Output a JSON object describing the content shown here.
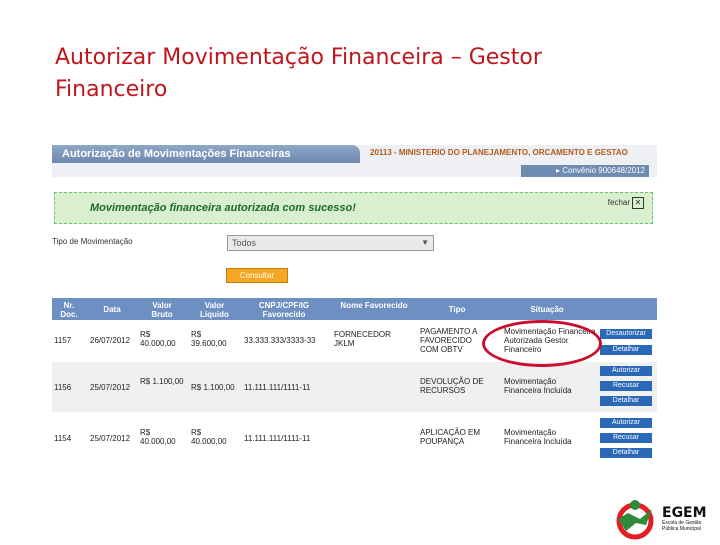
{
  "slide": {
    "title": "Autorizar Movimentação Financeira – Gestor Financeiro"
  },
  "header": {
    "title": "Autorização de Movimentações Financeiras",
    "org": "20113 - MINISTERIO DO PLANEJAMENTO, ORCAMENTO E GESTAO",
    "convenio": "▸ Convênio 900648/2012"
  },
  "message": {
    "text": "Movimentação financeira autorizada com sucesso!",
    "close_label": "fechar",
    "close_x": "✕"
  },
  "filter": {
    "label": "Tipo de Movimentação",
    "value": "Todos",
    "arrow": "▼",
    "button": "Consultar"
  },
  "table": {
    "headers": [
      "Nr. Doc.",
      "Data",
      "Valor Bruto",
      "Valor Líquido",
      "CNPJ/CPF/IG Favorecido",
      "Nome Favorecido",
      "Tipo",
      "Situação"
    ],
    "rows": [
      {
        "doc": "1157",
        "data": "26/07/2012",
        "bruto": "R$ 40.000,00",
        "liquido": "R$ 39.600,00",
        "cnpj": "33.333.333/3333-33",
        "nome": "FORNECEDOR JKLM",
        "tipo": "PAGAMENTO A FAVORECIDO COM OBTV",
        "situacao": "Movimentação Financeira Autorizada Gestor Financeiro",
        "actions": [
          "Desautorizar",
          "Detalhar"
        ]
      },
      {
        "doc": "1156",
        "data": "25/07/2012",
        "bruto": "R$ 1.100,00",
        "liquido": "R$ 1.100,00",
        "cnpj": "11.111.111/1111-11",
        "nome": "",
        "tipo": "DEVOLUÇÃO DE RECURSOS",
        "situacao": "Movimentação Financeira Incluída",
        "actions": [
          "Autorizar",
          "Recusar",
          "Detalhar"
        ]
      },
      {
        "doc": "1154",
        "data": "25/07/2012",
        "bruto": "R$ 40.000,00",
        "liquido": "R$ 40.000,00",
        "cnpj": "11.111.111/1111-11",
        "nome": "",
        "tipo": "APLICAÇÃO EM POUPANÇA",
        "situacao": "Movimentação Financeira Incluída",
        "actions": [
          "Autorizar",
          "Recusar",
          "Detalhar"
        ]
      }
    ]
  },
  "logo": {
    "name": "EGEM",
    "subtitle": "Escola de Gestão Pública Municipal"
  },
  "colors": {
    "title": "#c0151b",
    "header": "#6e8fc1",
    "success_bg": "#d9efcf",
    "accent_button": "#f5a623",
    "action_button": "#2a68b8",
    "highlight": "#c8102e"
  }
}
